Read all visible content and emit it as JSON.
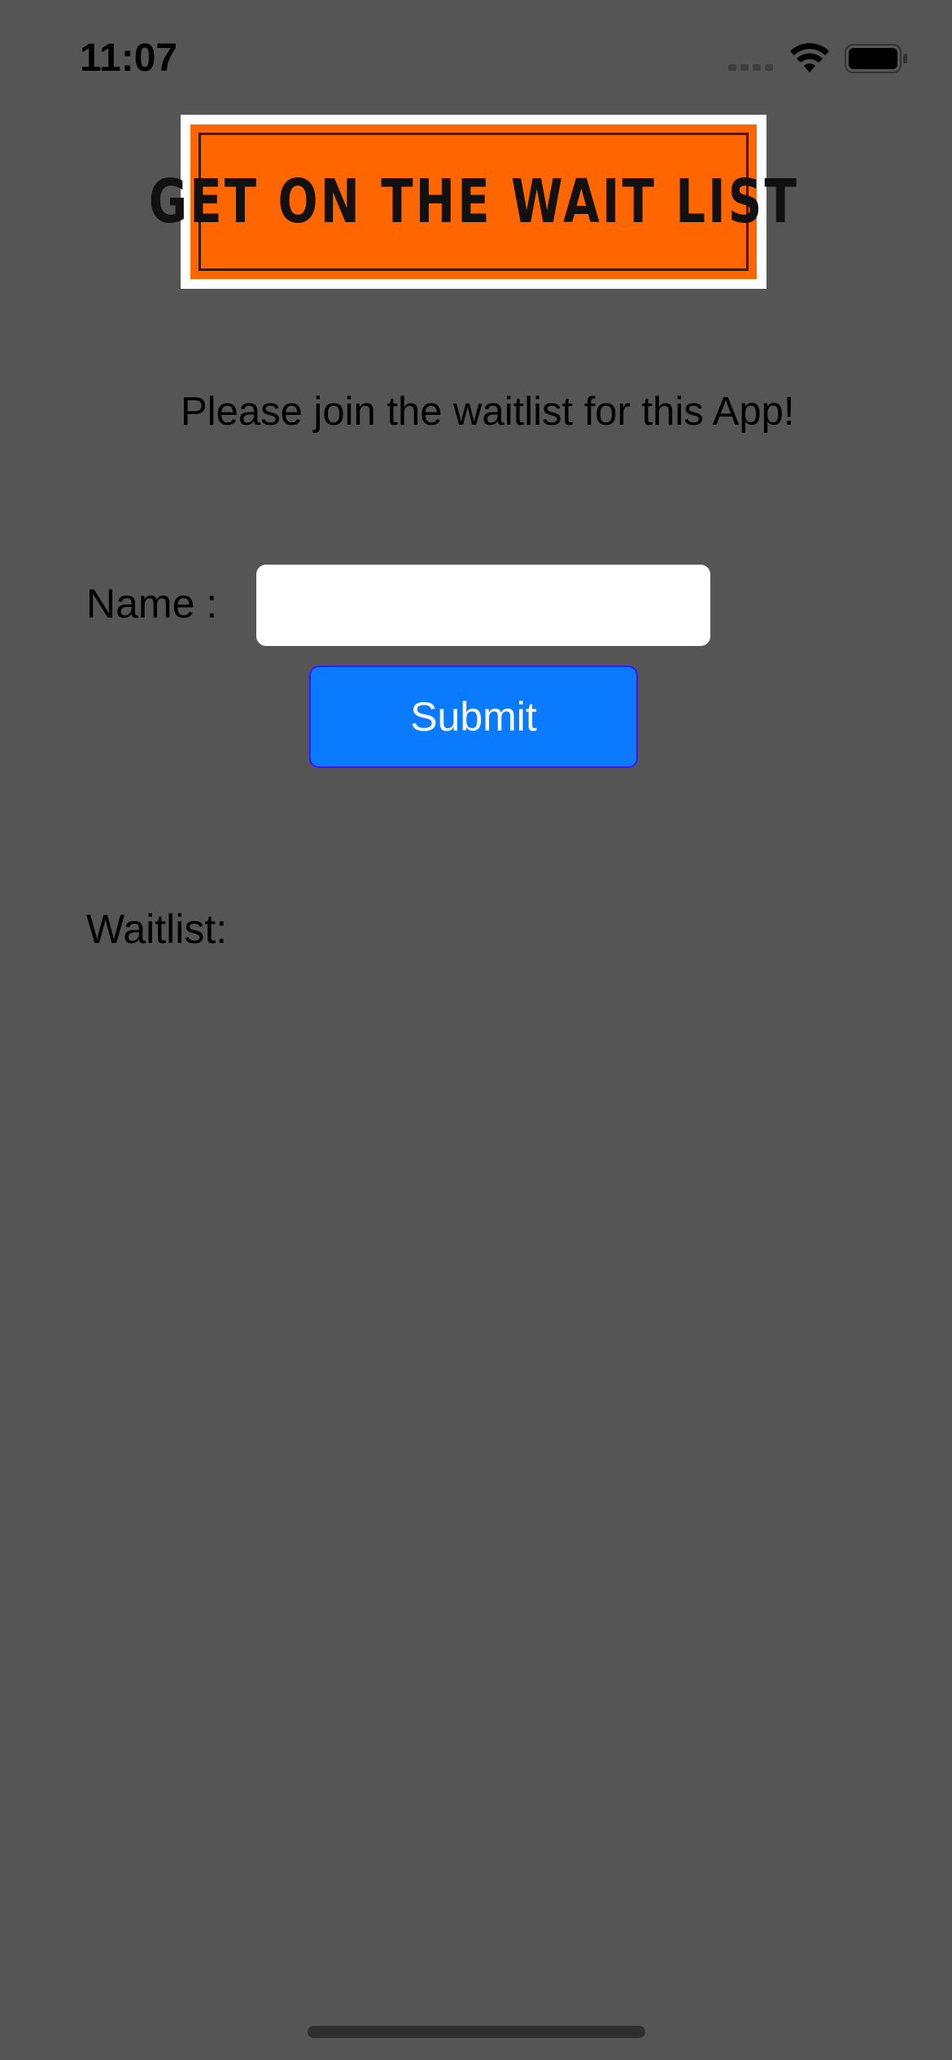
{
  "status_bar": {
    "time": "11:07",
    "icons": [
      "cellular-signal-icon",
      "wifi-icon",
      "battery-icon"
    ]
  },
  "banner": {
    "text": "GET ON THE WAIT LIST",
    "background_color": "#ff6600"
  },
  "subtitle": "Please join the waitlist for this App!",
  "form": {
    "name_label": "Name :",
    "name_value": "",
    "name_placeholder": "",
    "submit_label": "Submit",
    "submit_color": "#0a7bff"
  },
  "waitlist": {
    "label": "Waitlist:",
    "entries": []
  },
  "colors": {
    "screen_background": "#555555"
  }
}
